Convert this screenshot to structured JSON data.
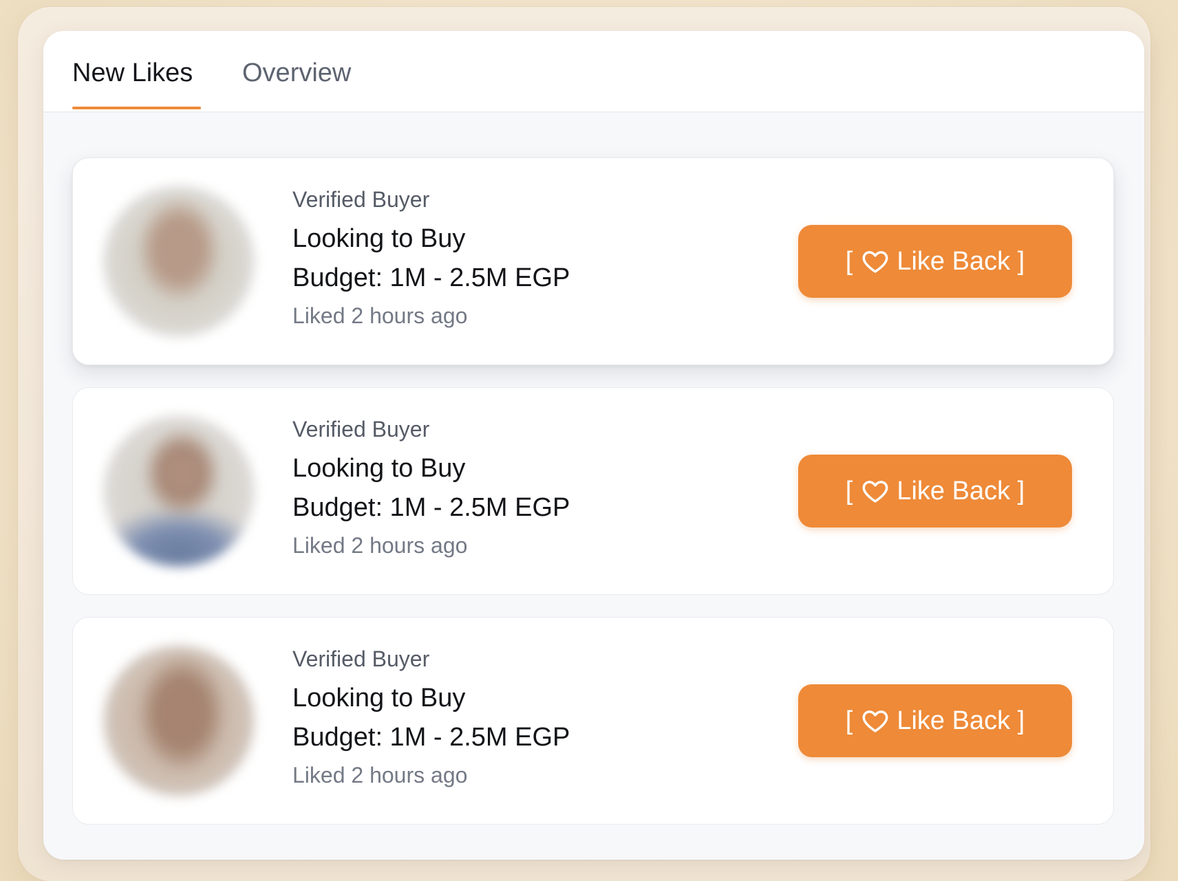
{
  "tabs": [
    {
      "label": "New Likes",
      "active": true
    },
    {
      "label": "Overview",
      "active": false
    }
  ],
  "accent_color": "#ee8a38",
  "likes": [
    {
      "badge": "Verified Buyer",
      "intent": "Looking to Buy",
      "budget": "Budget: 1M - 2.5M EGP",
      "time": "Liked 2 hours ago",
      "button_open": "[",
      "button_icon": "heart-icon",
      "button_label": "Like Back ]"
    },
    {
      "badge": "Verified Buyer",
      "intent": "Looking to Buy",
      "budget": "Budget: 1M - 2.5M EGP",
      "time": "Liked 2 hours ago",
      "button_open": "[",
      "button_icon": "heart-icon",
      "button_label": "Like Back ]"
    },
    {
      "badge": "Verified Buyer",
      "intent": "Looking to Buy",
      "budget": "Budget: 1M - 2.5M EGP",
      "time": "Liked 2 hours ago",
      "button_open": "[",
      "button_icon": "heart-icon",
      "button_label": "Like Back ]"
    }
  ]
}
